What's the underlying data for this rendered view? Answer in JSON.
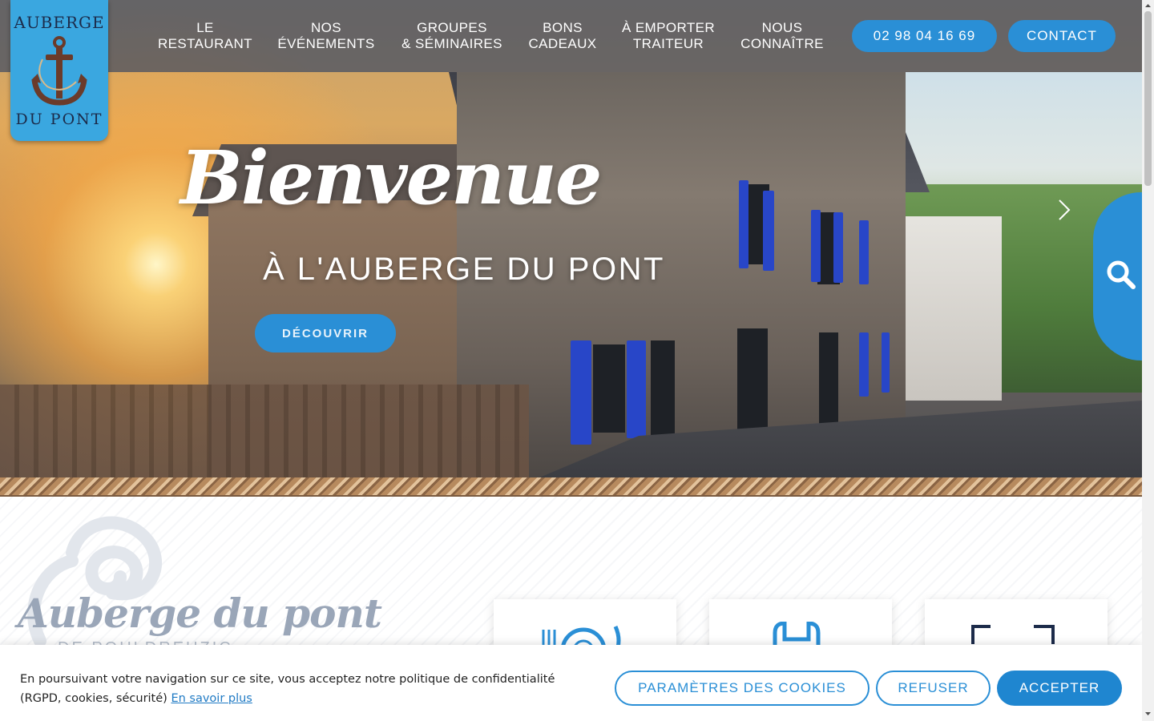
{
  "logo": {
    "top_text": "AUBERGE",
    "bottom_text": "DU PONT"
  },
  "nav": {
    "items": [
      {
        "line1": "LE",
        "line2": "RESTAURANT"
      },
      {
        "line1": "NOS",
        "line2": "ÉVÉNEMENTS"
      },
      {
        "line1": "GROUPES",
        "line2": "& SÉMINAIRES"
      },
      {
        "line1": "BONS",
        "line2": "CADEAUX"
      },
      {
        "line1": "À EMPORTER",
        "line2": "TRAITEUR"
      },
      {
        "line1": "NOUS",
        "line2": "CONNAÎTRE"
      }
    ],
    "phone": "02 98 04 16 69",
    "contact": "CONTACT"
  },
  "hero": {
    "title": "Bienvenue",
    "subtitle": "À L'AUBERGE DU PONT",
    "button": "DÉCOUVRIR"
  },
  "section": {
    "title": "Auberge du pont",
    "subtitle": "DE POULDREUZIC"
  },
  "cards": [
    {
      "icon": "plate-cutlery-icon"
    },
    {
      "icon": "bag-icon"
    },
    {
      "icon": "frame-icon"
    }
  ],
  "cookie": {
    "text": "En poursuivant votre navigation sur ce site, vous acceptez notre politique de confidentialité (RGPD, cookies, sécurité)",
    "link": "En savoir plus",
    "settings": "PARAMÈTRES DES COOKIES",
    "refuse": "REFUSER",
    "accept": "ACCEPTER"
  },
  "colors": {
    "accent": "#2a8fd6",
    "nav_overlay": "#283e62",
    "logo_bg": "#3aa7e0"
  }
}
